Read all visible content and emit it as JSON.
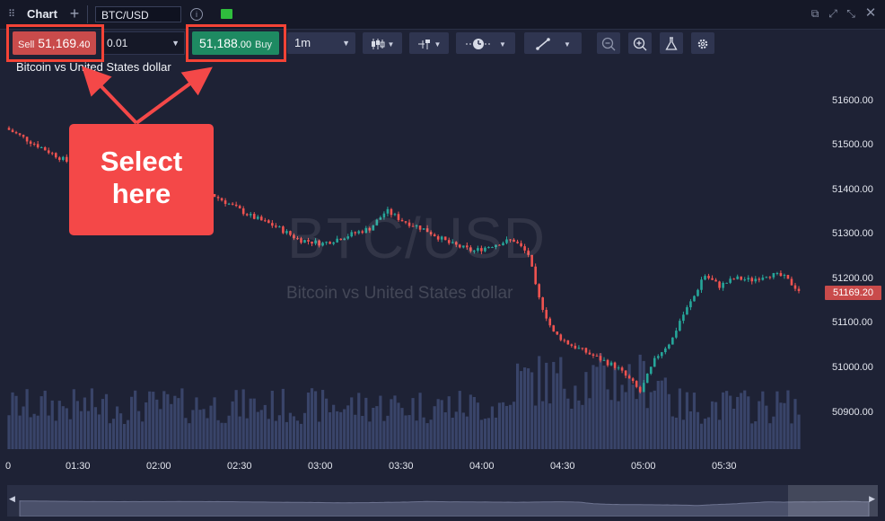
{
  "window": {
    "title": "Chart",
    "symbol": "BTC/USD",
    "info_icon": "info-icon",
    "status_color": "#2fbe3d"
  },
  "toolbar": {
    "sell_label": "Sell",
    "sell_price_main": "51,169",
    "sell_price_fraction": ".40",
    "quantity": "0.01",
    "buy_price_main": "51,188",
    "buy_price_fraction": ".00",
    "buy_label": "Buy",
    "timeframe": "1m",
    "icons": [
      "candlestick-icon",
      "indicator-icon",
      "clock-icon",
      "trendline-icon",
      "zoom-out-icon",
      "zoom-in-icon",
      "flask-icon",
      "settings-icon"
    ]
  },
  "chart": {
    "subtitle": "Bitcoin vs United States dollar",
    "watermark_symbol": "BTC/USD",
    "watermark_name": "Bitcoin vs United States dollar",
    "current_price_label": "51169.20",
    "y_ticks": [
      "51600.00",
      "51500.00",
      "51400.00",
      "51300.00",
      "51200.00",
      "51100.00",
      "51000.00",
      "50900.00"
    ],
    "x_ticks": [
      "0",
      "01:30",
      "02:00",
      "02:30",
      "03:00",
      "03:30",
      "04:00",
      "04:30",
      "05:00",
      "05:30"
    ],
    "colors": {
      "up": "#26a69a",
      "down": "#ef5350",
      "volume": "#3e4a72",
      "sell": "#c94b4b",
      "buy": "#1e8a62"
    }
  },
  "chart_data": {
    "type": "candlestick",
    "title": "",
    "ylim": [
      50850,
      51670
    ],
    "price_path": [
      [
        0,
        51590
      ],
      [
        0.04,
        51545
      ],
      [
        0.08,
        51500
      ],
      [
        0.14,
        51475
      ],
      [
        0.2,
        51460
      ],
      [
        0.24,
        51440
      ],
      [
        0.28,
        51395
      ],
      [
        0.31,
        51360
      ],
      [
        0.34,
        51335
      ],
      [
        0.37,
        51300
      ],
      [
        0.4,
        51290
      ],
      [
        0.43,
        51310
      ],
      [
        0.46,
        51330
      ],
      [
        0.48,
        51375
      ],
      [
        0.5,
        51350
      ],
      [
        0.53,
        51325
      ],
      [
        0.56,
        51290
      ],
      [
        0.59,
        51270
      ],
      [
        0.62,
        51290
      ],
      [
        0.64,
        51300
      ],
      [
        0.66,
        51260
      ],
      [
        0.67,
        51160
      ],
      [
        0.69,
        51060
      ],
      [
        0.71,
        51030
      ],
      [
        0.73,
        51010
      ],
      [
        0.75,
        50990
      ],
      [
        0.77,
        50970
      ],
      [
        0.79,
        50930
      ],
      [
        0.8,
        50905
      ],
      [
        0.82,
        50995
      ],
      [
        0.84,
        51040
      ],
      [
        0.85,
        51090
      ],
      [
        0.87,
        51160
      ],
      [
        0.88,
        51210
      ],
      [
        0.9,
        51180
      ],
      [
        0.92,
        51200
      ],
      [
        0.94,
        51195
      ],
      [
        0.96,
        51210
      ],
      [
        0.98,
        51205
      ],
      [
        1,
        51169
      ]
    ]
  },
  "callout": {
    "line1": "Select",
    "line2": "here",
    "color": "#f44848"
  }
}
